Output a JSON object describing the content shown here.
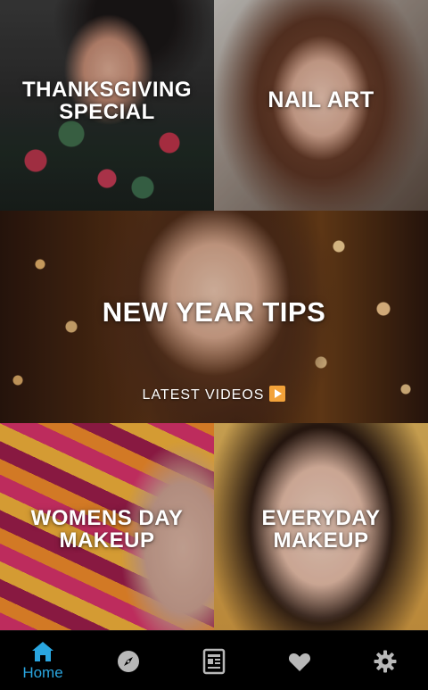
{
  "tiles": [
    {
      "title": "THANKSGIVING\nSPECIAL"
    },
    {
      "title": "NAIL ART"
    },
    {
      "title": "NEW YEAR TIPS",
      "subtitle": "LATEST VIDEOS"
    },
    {
      "title": "WOMENS DAY\nMAKEUP"
    },
    {
      "title": "EVERYDAY\nMAKEUP"
    }
  ],
  "bottom_nav": {
    "items": [
      {
        "label": "Home",
        "icon": "home-icon",
        "active": true
      },
      {
        "label": "",
        "icon": "compass-icon"
      },
      {
        "label": "",
        "icon": "news-icon"
      },
      {
        "label": "",
        "icon": "heart-icon"
      },
      {
        "label": "",
        "icon": "gear-icon"
      }
    ],
    "active_color": "#2aa6e0",
    "inactive_color": "#b8b8b8"
  },
  "colors": {
    "subtitle_arrow": "#f2a23a",
    "nav_background": "#000000"
  }
}
